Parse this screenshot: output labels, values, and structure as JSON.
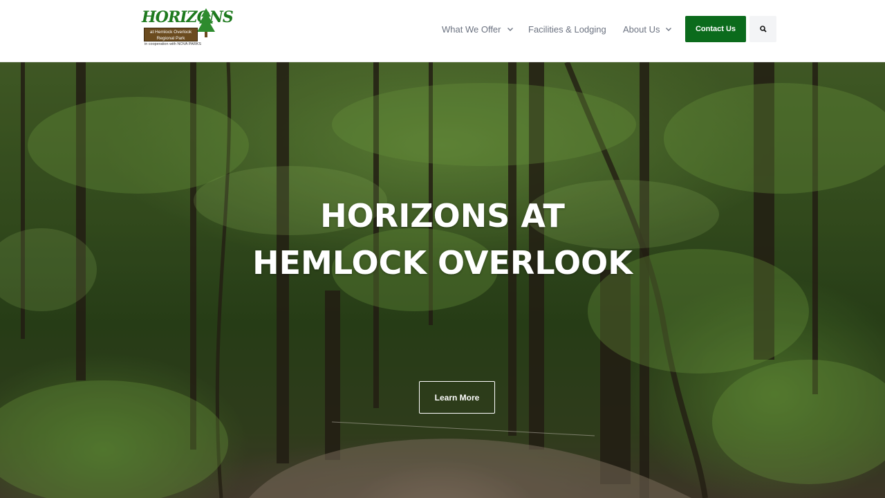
{
  "logo": {
    "wordmark": "HORIZONS",
    "sign_text": "at Hemlock Overlook Regional Park",
    "subtext": "in cooperation with NOVA PARKS"
  },
  "nav": {
    "items": [
      {
        "label": "What We Offer",
        "has_dropdown": true,
        "icon": "chevron-down-icon"
      },
      {
        "label": "Facilities & Lodging",
        "has_dropdown": false
      },
      {
        "label": "About Us",
        "has_dropdown": true,
        "icon": "chevron-down-icon"
      }
    ],
    "contact_label": "Contact Us",
    "search_icon": "search-icon"
  },
  "hero": {
    "title": "HORIZONS AT HEMLOCK OVERLOOK",
    "cta_label": "Learn More"
  },
  "colors": {
    "brand_green": "#0b6b1c",
    "nav_text": "#6b7280",
    "logo_green": "#1e7a1e",
    "sign_brown": "#6b4b1f"
  }
}
